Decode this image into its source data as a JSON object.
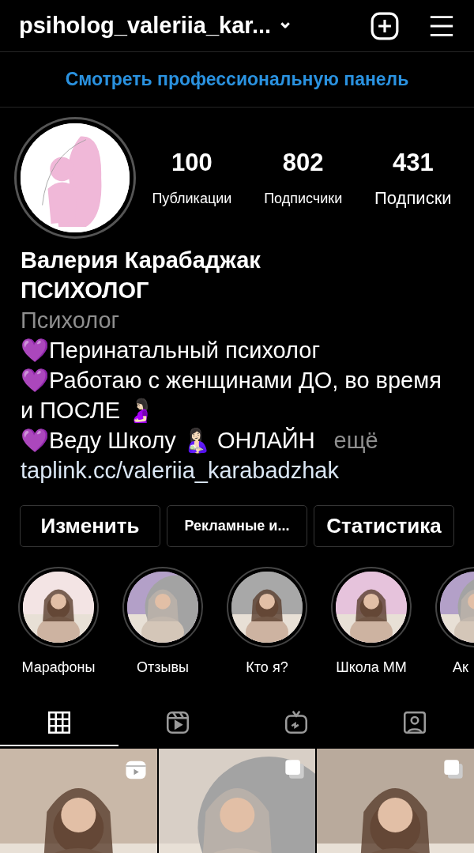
{
  "header": {
    "username": "psiholog_valeriia_kar...",
    "dropdown": "⌄"
  },
  "pro_link": "Смотреть профессиональную панель",
  "profile": {
    "stats": [
      {
        "value": "100",
        "label": "Публикации"
      },
      {
        "value": "802",
        "label": "Подписчики"
      },
      {
        "value": "431",
        "label": "Подписки"
      }
    ],
    "name": "Валерия Карабаджак ПСИХОЛОГ",
    "category": "Психолог",
    "bio": [
      "💜Перинатальный психолог",
      "💜Работаю с женщинами ДО, во время и ПОСЛЕ 🤰🏻",
      "💜Веду Школу 🤱🏻 ОНЛАЙН"
    ],
    "more": "ещё",
    "link": "taplink.cc/valeriia_karabadzhak"
  },
  "buttons": [
    "Изменить",
    "Рекламные и...",
    "Статистика"
  ],
  "highlights": [
    {
      "label": "Марафоны",
      "color": "#f3e4e4"
    },
    {
      "label": "Отзывы",
      "color": "#b3a0c8"
    },
    {
      "label": "Кто я?",
      "color": "#a8a8a8"
    },
    {
      "label": "Школа ММ",
      "color": "#e6c3dc"
    },
    {
      "label": "Ак",
      "color": "#b3a0c8"
    }
  ],
  "tabs": [
    {
      "kind": "grid",
      "selected": true
    },
    {
      "kind": "reels",
      "selected": false
    },
    {
      "kind": "tv",
      "selected": false
    },
    {
      "kind": "tagged",
      "selected": false
    }
  ],
  "posts": [
    {
      "kind": "reel"
    },
    {
      "kind": "carousel"
    },
    {
      "kind": "carousel"
    }
  ]
}
